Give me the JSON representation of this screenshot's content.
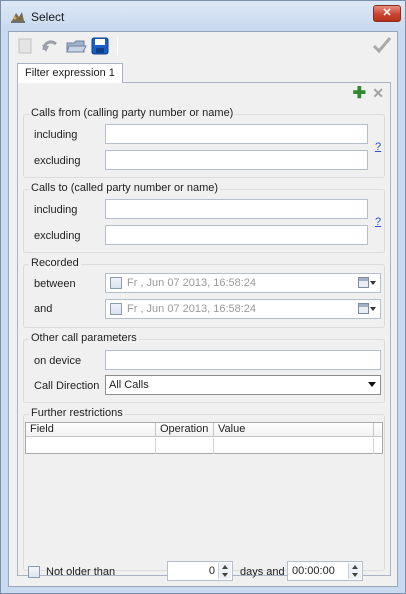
{
  "window": {
    "title": "Select",
    "close_glyph": "✕"
  },
  "toolbar": {
    "icons": [
      "new-icon",
      "undo-icon",
      "open-folder-icon",
      "save-icon",
      "ok-check-icon"
    ]
  },
  "tabs": [
    {
      "label": "Filter expression 1"
    }
  ],
  "expression": {
    "add_glyph": "✚",
    "remove_glyph": "✕"
  },
  "calls_from": {
    "title": "Calls from (calling party number or name)",
    "including_label": "including",
    "including_value": "",
    "excluding_label": "excluding",
    "excluding_value": "",
    "help": "?"
  },
  "calls_to": {
    "title": "Calls to (called party number or name)",
    "including_label": "including",
    "including_value": "",
    "excluding_label": "excluding",
    "excluding_value": "",
    "help": "?"
  },
  "recorded": {
    "title": "Recorded",
    "between_label": "between",
    "between_value": "Fr , Jun 07 2013, 16:58:24",
    "and_label": "and",
    "and_value": "Fr , Jun 07 2013, 16:58:24"
  },
  "other_params": {
    "title": "Other call parameters",
    "device_label": "on device",
    "device_value": "",
    "direction_label": "Call Direction",
    "direction_value": "All Calls"
  },
  "restrictions": {
    "title": "Further restrictions",
    "columns": [
      "Field",
      "Operation",
      "Value"
    ]
  },
  "bottom": {
    "not_older_label": "Not older than",
    "days_value": "0",
    "days_and_label": "days and",
    "time_value": "00:00:00"
  },
  "colors": {
    "accent": "#2f8a2f",
    "close": "#c9452f",
    "link": "#2a4fd4",
    "save": "#1c5fc4"
  }
}
